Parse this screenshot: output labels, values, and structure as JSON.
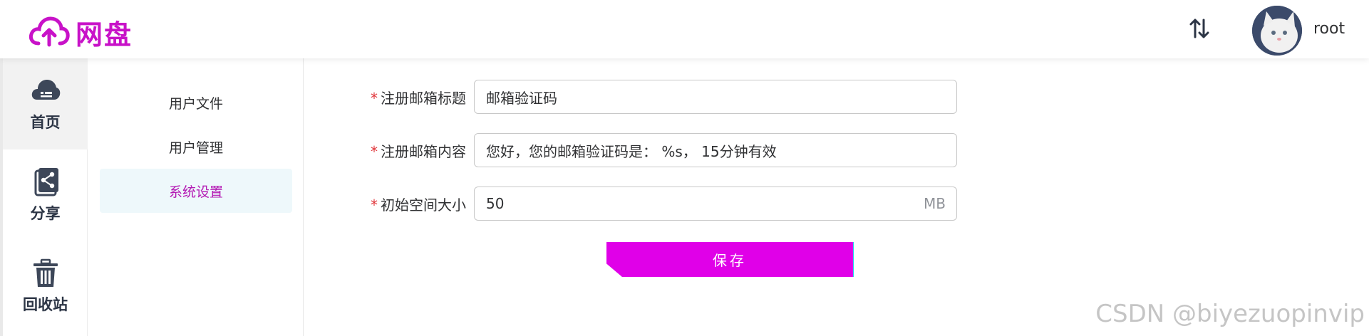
{
  "header": {
    "logo_text": "网盘",
    "username": "root",
    "brand_color": "#c812c8"
  },
  "icon_nav": {
    "items": [
      {
        "label": "首页",
        "icon": "cloud-icon"
      },
      {
        "label": "分享",
        "icon": "share-icon"
      },
      {
        "label": "回收站",
        "icon": "trash-icon"
      }
    ]
  },
  "sub_menu": {
    "items": [
      {
        "label": "用户文件"
      },
      {
        "label": "用户管理"
      },
      {
        "label": "系统设置"
      }
    ]
  },
  "form": {
    "required_mark": "*",
    "email_title": {
      "label": "注册邮箱标题",
      "value": "邮箱验证码"
    },
    "email_content": {
      "label": "注册邮箱内容",
      "value": "您好，您的邮箱验证码是： %s， 15分钟有效"
    },
    "initial_space": {
      "label": "初始空间大小",
      "value": "50",
      "suffix": "MB"
    },
    "save_label": "保存"
  },
  "watermark": "CSDN @biyezuopinvip"
}
